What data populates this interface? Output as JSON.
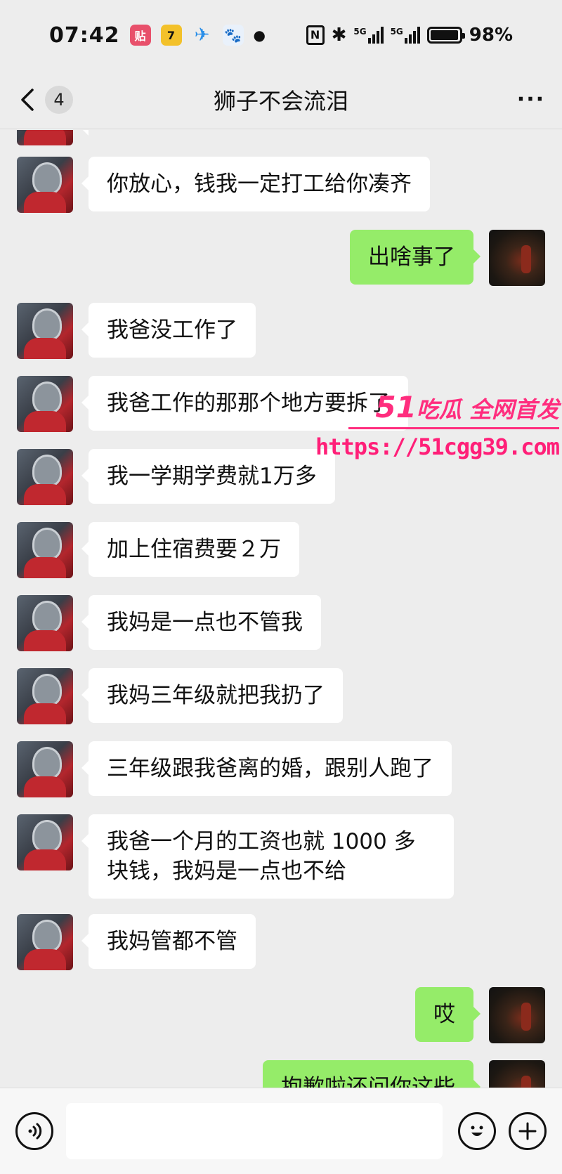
{
  "status_bar": {
    "time": "07:42",
    "apps": [
      "贴",
      "7",
      "✈",
      "🐾"
    ],
    "signal_label_1": "5G",
    "signal_label_2": "5G",
    "battery": "98%",
    "battery_level": 0.98
  },
  "nav": {
    "back_label": "back",
    "unread_count": "4",
    "title": "狮子不会流泪",
    "more_label": "···"
  },
  "messages": [
    {
      "side": "friend",
      "text": "你放心，钱我一定打工给你凑齐"
    },
    {
      "side": "self",
      "text": "出啥事了"
    },
    {
      "side": "friend",
      "text": "我爸没工作了"
    },
    {
      "side": "friend",
      "text": "我爸工作的那那个地方要拆了"
    },
    {
      "side": "friend",
      "text": "我一学期学费就1万多"
    },
    {
      "side": "friend",
      "text": "加上住宿费要２万"
    },
    {
      "side": "friend",
      "text": "我妈是一点也不管我"
    },
    {
      "side": "friend",
      "text": "我妈三年级就把我扔了"
    },
    {
      "side": "friend",
      "text": "三年级跟我爸离的婚，跟别人跑了"
    },
    {
      "side": "friend",
      "text": "我爸一个月的工资也就 1000 多块钱，我妈是一点也不给"
    },
    {
      "side": "friend",
      "text": "我妈管都不管"
    },
    {
      "side": "self",
      "text": "哎"
    },
    {
      "side": "self",
      "text": "抱歉啦还问你这些"
    }
  ],
  "watermark": {
    "brand_number": "51",
    "brand_text": "吃瓜 全网首发",
    "url": "https://51cgg39.com"
  },
  "input_bar": {
    "voice_icon": "voice-icon",
    "emoji_icon": "emoji-icon",
    "plus_icon": "plus-icon",
    "input_value": ""
  }
}
